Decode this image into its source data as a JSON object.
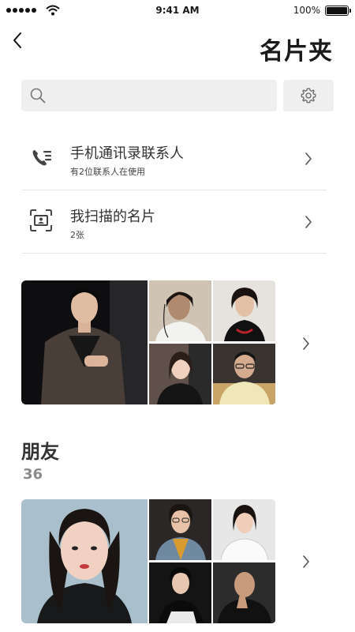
{
  "status_bar": {
    "time": "9:41 AM",
    "battery": "100%"
  },
  "header": {
    "title": "名片夹"
  },
  "search": {
    "placeholder": ""
  },
  "list": [
    {
      "title": "手机通讯录联系人",
      "subtitle": "有2位联系人在使用",
      "icon": "phone-book-icon"
    },
    {
      "title": "我扫描的名片",
      "subtitle": "2张",
      "icon": "scan-card-icon"
    }
  ],
  "groups": [
    {
      "name": "",
      "count": ""
    },
    {
      "name": "朋友",
      "count": "36"
    }
  ],
  "colors": {
    "accent_text": "#333333",
    "muted": "#8a8a8a",
    "field_bg": "#efefef"
  }
}
